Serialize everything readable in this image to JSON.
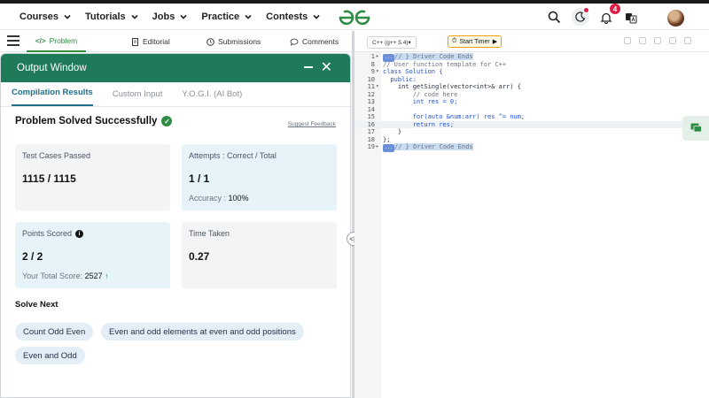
{
  "topnav": {
    "menu": [
      {
        "label": "Courses"
      },
      {
        "label": "Tutorials"
      },
      {
        "label": "Jobs"
      },
      {
        "label": "Practice"
      },
      {
        "label": "Contests"
      }
    ],
    "notification_count": "4"
  },
  "problem_tabs": [
    {
      "label": "Problem",
      "icon": "code-icon"
    },
    {
      "label": "Editorial",
      "icon": "document-icon"
    },
    {
      "label": "Submissions",
      "icon": "clock-icon"
    },
    {
      "label": "Comments",
      "icon": "comment-icon"
    }
  ],
  "output_window": {
    "title": "Output Window",
    "tabs": [
      "Compilation Results",
      "Custom Input",
      "Y.O.G.I. (AI Bot)"
    ],
    "status": "Problem Solved Successfully",
    "feedback_link": "Suggest Feedback",
    "cards": {
      "test_cases": {
        "label": "Test Cases Passed",
        "value": "1115 / 1115"
      },
      "attempts": {
        "label": "Attempts : Correct / Total",
        "value": "1 / 1",
        "sub_label": "Accuracy :",
        "sub_value": "100%"
      },
      "points": {
        "label": "Points Scored",
        "value": "2 / 2",
        "sub_label": "Your Total Score:",
        "sub_value": "2527"
      },
      "time": {
        "label": "Time Taken",
        "value": "0.27"
      }
    },
    "solve_next_title": "Solve Next",
    "solve_next": [
      "Count Odd Even",
      "Even and odd elements at even and odd positions",
      "Even and Odd"
    ]
  },
  "editor": {
    "language": "C++ (g++ 5.4)",
    "timer_label": "Start Timer",
    "lines": [
      {
        "num": "1",
        "fold": "▸",
        "tag": "...",
        "text": "// } Driver Code Ends",
        "cls": "cm",
        "hl": true
      },
      {
        "num": "8",
        "fold": "",
        "tag": "",
        "text": "// User function template for C++",
        "cls": "cm",
        "hl": false
      },
      {
        "num": "9",
        "fold": "▾",
        "tag": "",
        "text": "class Solution {",
        "cls": "kw",
        "hl": false
      },
      {
        "num": "10",
        "fold": "",
        "tag": "",
        "text": "  public:",
        "cls": "kw",
        "hl": false
      },
      {
        "num": "11",
        "fold": "▾",
        "tag": "",
        "text": "    int getSingle(vector<int>& arr) {",
        "cls": "",
        "hl": false
      },
      {
        "num": "12",
        "fold": "",
        "tag": "",
        "text": "        // code here",
        "cls": "cm",
        "hl": false
      },
      {
        "num": "13",
        "fold": "",
        "tag": "",
        "text": "        int res = 0;",
        "cls": "kw",
        "hl": false
      },
      {
        "num": "14",
        "fold": "",
        "tag": "",
        "text": "",
        "cls": "",
        "hl": false
      },
      {
        "num": "15",
        "fold": "",
        "tag": "",
        "text": "        for(auto &num:arr) res ^= num;",
        "cls": "kw",
        "hl": false
      },
      {
        "num": "16",
        "fold": "",
        "tag": "",
        "text": "        return res;",
        "cls": "kw",
        "hl": false,
        "cur": true
      },
      {
        "num": "17",
        "fold": "",
        "tag": "",
        "text": "    }",
        "cls": "",
        "hl": false
      },
      {
        "num": "18",
        "fold": "",
        "tag": "",
        "text": "};",
        "cls": "",
        "hl": false
      },
      {
        "num": "19",
        "fold": "▸",
        "tag": "...",
        "text": "// } Driver Code Ends",
        "cls": "cm",
        "hl": true
      }
    ]
  },
  "colors": {
    "brand_green": "#2f8d46",
    "header_green": "#1f7a5a",
    "accent_blue": "#1f6f8b"
  }
}
